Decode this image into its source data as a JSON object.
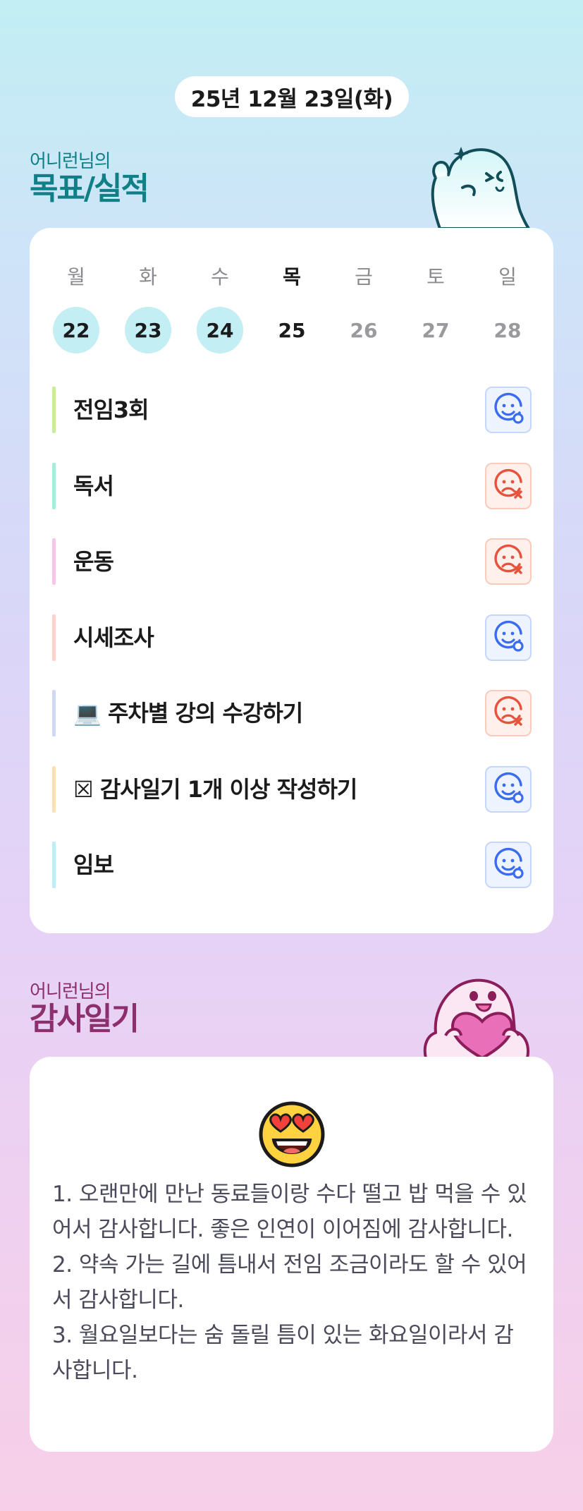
{
  "date": "25년 12월 23일(화)",
  "goals_section": {
    "owner": "어니런님의",
    "title": "목표/실적"
  },
  "week": [
    {
      "weekday": "월",
      "day": "22",
      "state": "done"
    },
    {
      "weekday": "화",
      "day": "23",
      "state": "done"
    },
    {
      "weekday": "수",
      "day": "24",
      "state": "done"
    },
    {
      "weekday": "목",
      "day": "25",
      "state": "today"
    },
    {
      "weekday": "금",
      "day": "26",
      "state": "future"
    },
    {
      "weekday": "토",
      "day": "27",
      "state": "future"
    },
    {
      "weekday": "일",
      "day": "28",
      "state": "future"
    }
  ],
  "goals": [
    {
      "name": "전임3회",
      "color": "#c9ec9a",
      "status": "success"
    },
    {
      "name": "독서",
      "color": "#a8ecd9",
      "status": "fail"
    },
    {
      "name": "운동",
      "color": "#f8c4ea",
      "status": "fail"
    },
    {
      "name": "시세조사",
      "color": "#fdd3cc",
      "status": "success"
    },
    {
      "name": "💻 주차별 강의 수강하기",
      "color": "#cfd8f5",
      "status": "fail"
    },
    {
      "name": "☒ 감사일기 1개 이상 작성하기",
      "color": "#fde0b3",
      "status": "success"
    },
    {
      "name": "임보",
      "color": "#bdeef6",
      "status": "success"
    }
  ],
  "gratitude_section": {
    "owner": "어니런님의",
    "title": "감사일기"
  },
  "gratitude": {
    "mood_icon": "heart-eyes-emoji-icon",
    "entries": [
      "1. 오랜만에 만난 동료들이랑 수다 떨고 밥 먹을 수 있어서 감사합니다. 좋은 인연이 이어짐에 감사합니다.",
      "2. 약속 가는 길에 틈내서 전임 조금이라도 할 수 있어서 감사합니다.",
      "3. 월요일보다는 숨 돌릴 틈이 있는 화요일이라서 감사합니다."
    ]
  },
  "colors": {
    "accent_teal": "#117f86",
    "accent_plum": "#8c2f6d",
    "done_circle": "#c2eef4",
    "success_icon": "#3b6cf0",
    "fail_icon": "#e5533c"
  }
}
